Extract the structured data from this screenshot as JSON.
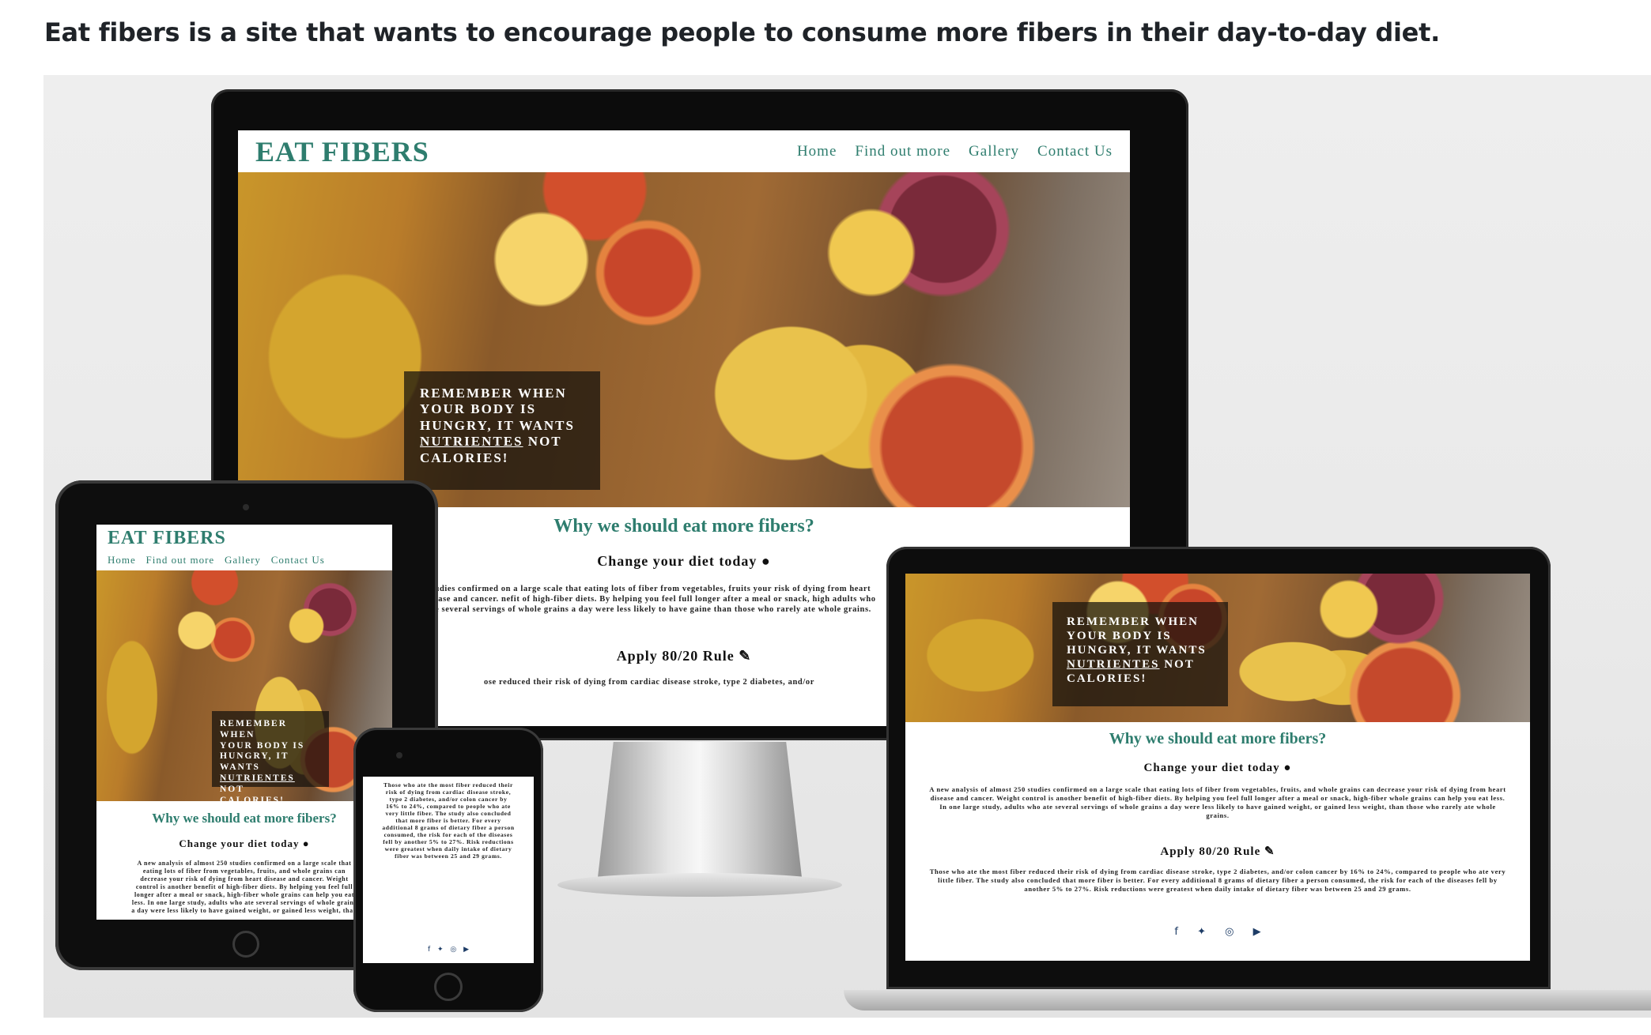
{
  "caption": "Eat fibers is a site that wants to encourage people to consume more fibers in their day-to-day diet.",
  "site": {
    "logo": "EAT FIBERS",
    "nav": {
      "home": "Home",
      "find": "Find out more",
      "gallery": "Gallery",
      "contact": "Contact Us"
    },
    "quote": {
      "line1": "REMEMBER WHEN",
      "line2": "YOUR BODY IS",
      "line3": "HUNGRY, IT WANTS",
      "nutrientes": "NUTRIENTES",
      "not": "NOT",
      "calories": "CALORIES!"
    },
    "heading": "Why we should eat more fibers?",
    "change_diet": "Change your diet today",
    "apply_rule": "Apply 80/20 Rule",
    "para1": "A new analysis of almost 250 studies confirmed on a large scale that eating lots of fiber from vegetables, fruits, and whole grains can decrease your risk of dying from heart disease and cancer.",
    "para2": "Weight control is another benefit of high-fiber diets. By helping you feel full longer after a meal or snack, high-fiber whole grains can help you eat less. In one large study, adults who ate several servings of whole grains a day were less likely to have gained weight, or gained less weight, than those who rarely ate whole grains.",
    "para3": "Those who ate the most fiber reduced their risk of dying from cardiac disease stroke, type 2 diabetes, and/or colon cancer by 16% to 24%, compared to people who ate very little fiber. The study also concluded that more fiber is better. For every additional 8 grams of dietary fiber a person consumed, the risk for each of the diseases fell by another 5% to 27%. Risk reductions were greatest when daily intake of dietary fiber was between 25 and 29 grams.",
    "monitor_para": "studies confirmed on a large scale that eating lots of fiber from vegetables, fruits your risk of dying from heart disease and cancer. nefit of high-fiber diets. By helping you feel full longer after a meal or snack, high adults who ate several servings of whole grains a day were less likely to have gaine than those who rarely ate whole grains.",
    "monitor_cut": "ose reduced their risk of dying from cardiac disease stroke, type 2 diabetes, and/or",
    "icons": {
      "apple": "apple-icon",
      "carrot": "carrot-icon",
      "social": [
        "facebook-icon",
        "twitter-icon",
        "instagram-icon",
        "youtube-icon"
      ]
    }
  },
  "colors": {
    "brand": "#2e7d6e",
    "text": "#222222",
    "icon": "#1d3c66"
  }
}
